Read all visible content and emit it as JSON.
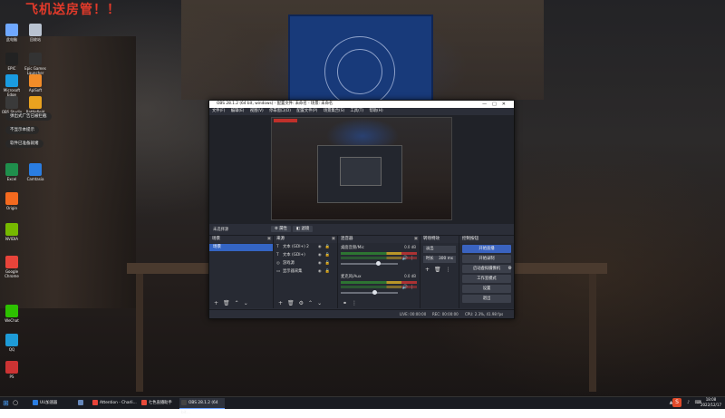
{
  "desktop": {
    "banner_text": "飞机送房管！！",
    "icons": [
      {
        "label": "此电脑",
        "color": "#6fa8ff"
      },
      {
        "label": "回收站",
        "color": "#b9c3d1"
      },
      {
        "label": "EPIC",
        "color": "#222222"
      },
      {
        "label": "Epic Games Launcher",
        "color": "#333333"
      },
      {
        "label": "Microsoft Edge",
        "color": "#1a9be0"
      },
      {
        "label": "ApiSoft",
        "color": "#f28c28"
      },
      {
        "label": "OBS Studio",
        "color": "#3a3a3a"
      },
      {
        "label": "Battlefield",
        "color": "#e9a21f"
      },
      {
        "label": "Excel",
        "color": "#1f8f4c"
      },
      {
        "label": "Camtasia",
        "color": "#2a7de1"
      },
      {
        "label": "Origin",
        "color": "#f46a1f"
      },
      {
        "label": "NVIDIA",
        "color": "#76b900"
      },
      {
        "label": "Google Chrome",
        "color": "#e8443a"
      },
      {
        "label": "WeChat",
        "color": "#2dc100"
      },
      {
        "label": "QQ",
        "color": "#1e9bd7"
      },
      {
        "label": "PS",
        "color": "#cc3333"
      }
    ],
    "balloons": [
      "弹出式广告已被拦截",
      "不显示本提示",
      "软件已准备就绪"
    ]
  },
  "obs": {
    "title": "OBS 28.1.2 (64 bit, windows) - 配置文件: 未命名 - 场景: 未命名",
    "menu": [
      "文件(F)",
      "编辑(E)",
      "视图(V)",
      "停靠窗口(D)",
      "配置文件(P)",
      "场景集合(S)",
      "工具(T)",
      "帮助(H)"
    ],
    "current_source": "未选择源",
    "prop_button": "属性",
    "filter_button": "滤镜",
    "docks": {
      "scenes": "场景",
      "sources": "来源",
      "mixer": "混音器",
      "transitions": "转场特效",
      "controls": "控制按钮"
    },
    "scene_items": [
      "场景"
    ],
    "source_items": [
      {
        "icon": "text-icon",
        "glyph": "T",
        "name": "文本 (GDI+) 2"
      },
      {
        "icon": "text-icon",
        "glyph": "T",
        "name": "文本 (GDI+)"
      },
      {
        "icon": "browser-icon",
        "glyph": "◎",
        "name": "游戏源"
      },
      {
        "icon": "monitor-icon",
        "glyph": "▭",
        "name": "显示器采集"
      }
    ],
    "mixer_channels": [
      {
        "name": "桌面音频/Mic",
        "db": "0.0 dB",
        "level": 0.62
      },
      {
        "name": "麦克风/Aux",
        "db": "0.0 dB",
        "level": 0.55
      }
    ],
    "transition": {
      "type": "淡出",
      "duration_label": "时长",
      "duration": "300 ms"
    },
    "controls": [
      "开始直播",
      "开始录制",
      "启动虚拟摄像机",
      "工作室模式",
      "设置",
      "退出"
    ],
    "status": {
      "live": "LIVE: 00:00:00",
      "rec": "REC: 00:00:00",
      "cpu": "CPU: 2.3%, 41.98 fps"
    }
  },
  "taskbar": {
    "apps": [
      {
        "label": "UU加速器",
        "color": "#2a7de1"
      },
      {
        "label": "",
        "color": "#6688bb"
      },
      {
        "label": "Attention - Charli...",
        "color": "#e8443a"
      },
      {
        "label": "七色直播助手",
        "color": "#e84a3a"
      },
      {
        "label": "OBS 28.1.2 (64 bit...",
        "color": "#444444",
        "active": true
      }
    ],
    "ime": "S",
    "time": "18:08",
    "date": "2022/12/17"
  }
}
